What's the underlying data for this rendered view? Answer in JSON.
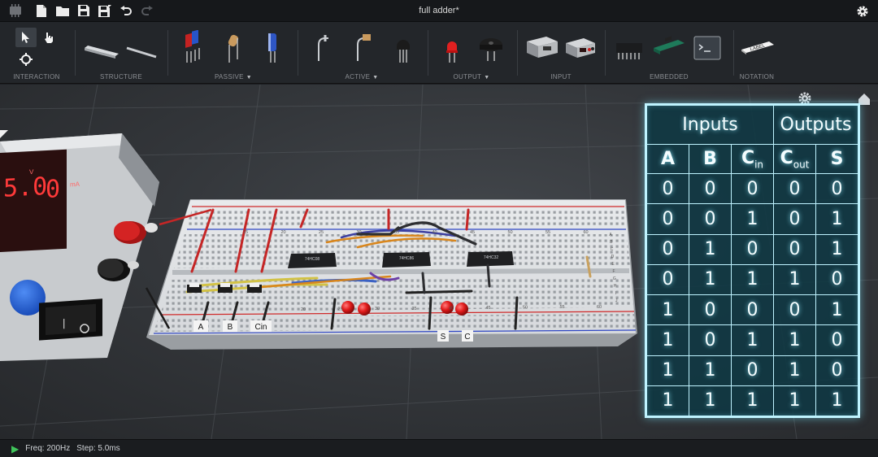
{
  "window": {
    "title": "full adder*"
  },
  "topbar": {
    "icons": [
      "app-logo-icon",
      "new-file-icon",
      "open-folder-icon",
      "save-icon",
      "save-as-icon",
      "undo-icon",
      "redo-icon",
      "settings-gear-icon"
    ]
  },
  "toolbar": {
    "groups": [
      {
        "label": "INTERACTION"
      },
      {
        "label": "STRUCTURE"
      },
      {
        "label": "PASSIVE",
        "has_dropdown": true
      },
      {
        "label": "ACTIVE",
        "has_dropdown": true
      },
      {
        "label": "OUTPUT",
        "has_dropdown": true
      },
      {
        "label": "INPUT"
      },
      {
        "label": "EMBEDDED"
      },
      {
        "label": "NOTATION"
      }
    ],
    "notation_item": "LABEL"
  },
  "power_supply": {
    "voltage": "5.0",
    "current": "0",
    "volt_unit": "V",
    "amp_unit": "mA"
  },
  "breadboard": {
    "chips": [
      "74HC08",
      "74HC86",
      "74HC32"
    ],
    "input_labels": [
      "A",
      "B",
      "Cin"
    ],
    "output_labels": [
      "S",
      "C"
    ],
    "column_numbers_top": [
      "15",
      "20",
      "25",
      "30",
      "35",
      "40",
      "45",
      "50",
      "55",
      "60"
    ],
    "column_numbers_bottom": [
      "20",
      "25",
      "30",
      "35",
      "40",
      "45",
      "50",
      "55",
      "60"
    ],
    "row_letters": [
      "A",
      "B",
      "C",
      "D",
      "E",
      "F",
      "G",
      "H",
      "I",
      "J"
    ]
  },
  "truth_table": {
    "group_headers": [
      "Inputs",
      "Outputs"
    ],
    "columns": [
      {
        "main": "A",
        "sub": ""
      },
      {
        "main": "B",
        "sub": ""
      },
      {
        "main": "C",
        "sub": "in"
      },
      {
        "main": "C",
        "sub": "out"
      },
      {
        "main": "S",
        "sub": ""
      }
    ],
    "rows": [
      [
        "0",
        "0",
        "0",
        "0",
        "0"
      ],
      [
        "0",
        "0",
        "1",
        "0",
        "1"
      ],
      [
        "0",
        "1",
        "0",
        "0",
        "1"
      ],
      [
        "0",
        "1",
        "1",
        "1",
        "0"
      ],
      [
        "1",
        "0",
        "0",
        "0",
        "1"
      ],
      [
        "1",
        "0",
        "1",
        "1",
        "0"
      ],
      [
        "1",
        "1",
        "0",
        "1",
        "0"
      ],
      [
        "1",
        "1",
        "1",
        "1",
        "1"
      ]
    ]
  },
  "status_bar": {
    "freq": "Freq: 200Hz",
    "step": "Step: 5.0ms"
  },
  "colors": {
    "accent_glow": "#bff3ff",
    "table_bg": "#0e3844",
    "play_green": "#3fc45a",
    "led_red": "#e11b1b",
    "wire_red": "#d22a2a"
  }
}
